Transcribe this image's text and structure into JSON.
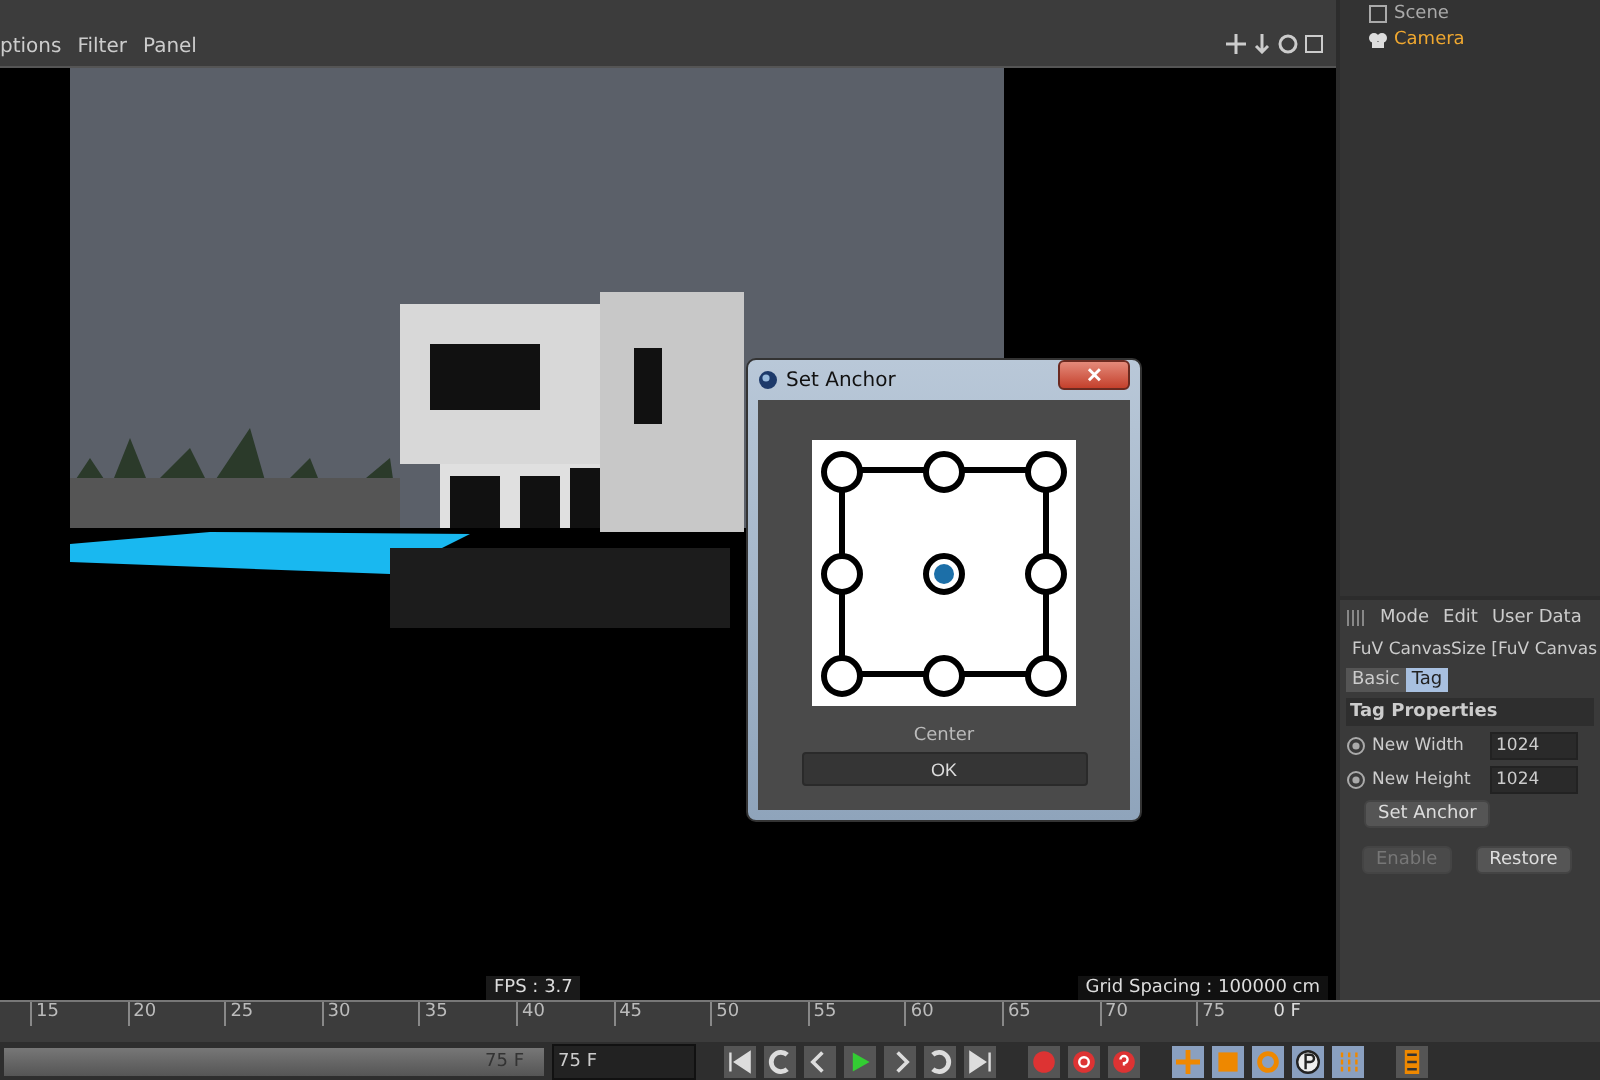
{
  "viewport_menu": [
    "ptions",
    "Filter",
    "Panel"
  ],
  "object_manager": {
    "items": [
      {
        "label": "Scene",
        "selected": false
      },
      {
        "label": "Camera",
        "selected": true
      }
    ]
  },
  "viewport": {
    "fps": "FPS : 3.7",
    "grid_spacing": "Grid Spacing : 100000 cm"
  },
  "dialog": {
    "title": "Set Anchor",
    "anchors": [
      {
        "selected": false
      },
      {
        "selected": false
      },
      {
        "selected": false
      },
      {
        "selected": false
      },
      {
        "selected": true
      },
      {
        "selected": false
      },
      {
        "selected": false
      },
      {
        "selected": false
      },
      {
        "selected": false
      }
    ],
    "anchor_label": "Center",
    "ok": "OK",
    "close": "✕"
  },
  "attributes": {
    "menu": [
      "Mode",
      "Edit",
      "User Data"
    ],
    "object": "FuV CanvasSize [FuV Canvas",
    "tabs": [
      {
        "label": "Basic",
        "selected": false
      },
      {
        "label": "Tag",
        "selected": true
      }
    ],
    "section": "Tag Properties",
    "fields": [
      {
        "label": "New Width",
        "value": "1024"
      },
      {
        "label": "New Height",
        "value": "1024"
      }
    ],
    "set_anchor": "Set Anchor",
    "buttons": [
      {
        "label": "Enable",
        "disabled": true
      },
      {
        "label": "Restore",
        "disabled": false
      }
    ]
  },
  "timeline": {
    "ticks": [
      "15",
      "20",
      "25",
      "30",
      "35",
      "40",
      "45",
      "50",
      "55",
      "60",
      "65",
      "70",
      "75"
    ],
    "current": "0 F",
    "range": {
      "label": "75 F",
      "level": 1
    },
    "end_field": "75 F"
  }
}
